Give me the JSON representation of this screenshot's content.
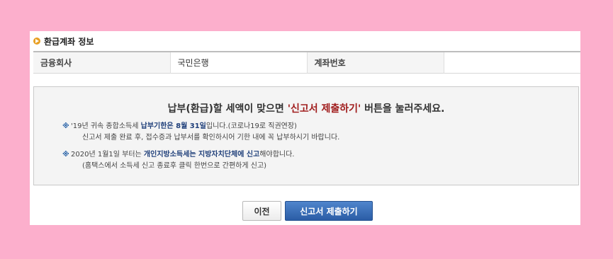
{
  "section": {
    "title": "환급계좌 정보",
    "icon": "arrow-bullet-icon"
  },
  "account": {
    "bank_label": "금융회사",
    "bank_value": "국민은행",
    "number_label": "계좌번호",
    "number_value": ""
  },
  "notice": {
    "headline_pre": "납부(환급)할 세액이 맞으면 ",
    "headline_highlight": "'신고서 제출하기'",
    "headline_post": " 버튼을 눌러주세요.",
    "note1": {
      "mark": "※",
      "text_a": "'19년 귀속 종합소득세 ",
      "bold_a": "납부기한은 8월 31일",
      "text_b": "입니다.(코로나19로 직권연장)",
      "line2": "신고서 제출 완료 후, 접수증과 납부서를 확인하시어 기한 내에 꼭 납부하시기 바랍니다."
    },
    "note2": {
      "mark": "※",
      "text_a": "2020년 1월1일 부터는 ",
      "bold_a": "개인지방소득세는 지방자치단체에 신고",
      "text_b": "해야합니다.",
      "line2": "(홈택스에서 소득세 신고 종료후 클릭 한번으로 간편하게 신고)"
    }
  },
  "buttons": {
    "prev": "이전",
    "submit": "신고서 제출하기"
  },
  "colors": {
    "background": "#fcafcc",
    "accent_red": "#a01c1c",
    "submit_blue": "#2b5da6"
  }
}
